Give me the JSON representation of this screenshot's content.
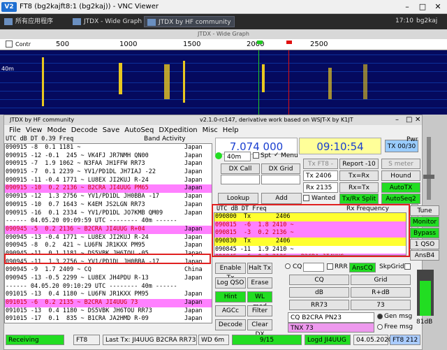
{
  "vnc": {
    "title": "FT8 (bg2kajft8:1 (bg2kaj)) - VNC Viewer",
    "time": "17:10",
    "user": "bg2kaj"
  },
  "taskbar": {
    "items": [
      "所有应用程序",
      "JTDX - Wide Graph",
      "JTDX by HF community"
    ]
  },
  "wide_graph": {
    "title": "JTDX - Wide Graph",
    "ticks": [
      "500",
      "1000",
      "1500",
      "2000",
      "2500"
    ],
    "label": "Contr",
    "band": "40m"
  },
  "jtdx": {
    "title": "JTDX by HF community",
    "version": "v2.1.0-rc147, derivative work based on WSJT-X by K1JT",
    "menu": [
      "File",
      "View",
      "Mode",
      "Decode",
      "Save",
      "AutoSeq",
      "DXpedition",
      "Misc",
      "Help"
    ],
    "header": "UTC  dB  DT 0.39  Freq",
    "band_activity": "Band Activity"
  },
  "band_activity": [
    {
      "t": "090915 -8  0.1 1181 ~ ",
      "c": "Japan",
      "cls": ""
    },
    {
      "t": "090915 -12 -0.1  245 ~ VK4FJ JR7NMH QN00",
      "c": "Japan",
      "cls": ""
    },
    {
      "t": "090915 -7  1.9 1062 ~ N3FAA JH1FFW RR73",
      "c": "Japan",
      "cls": ""
    },
    {
      "t": "090915 -7  0.1 2239 ~ YV1/PD1DL JH7IAJ -22",
      "c": "Japan",
      "cls": ""
    },
    {
      "t": "090915 -11 -0.4 1771 ~ LU8EX JI2KUJ R-24",
      "c": "Japan",
      "cls": ""
    },
    {
      "t": "090915 -10  0.2 2136 ~ B2CRA JI4UUG PM65",
      "c": "Japan",
      "cls": "pink red"
    },
    {
      "t": "090915 -12  1.3 2756 ~ YV1/PD1DL JH0BBA -17",
      "c": "Japan",
      "cls": ""
    },
    {
      "t": "090915 -10  0.7 1643 ~ K4EM JS2LGN RR73",
      "c": "Japan",
      "cls": ""
    },
    {
      "t": "090915 -16  0.1 2334 ~ YV1/PD1DL JO7KMB QM09",
      "c": "Japan",
      "cls": ""
    },
    {
      "t": "------ 04.05.20 09:09:59 UTC -------- 40m ------",
      "c": "",
      "cls": "ruler"
    },
    {
      "t": "090945 -5  0.2 2136 ~ B2CRA JI4UUG R+04",
      "c": "Japan",
      "cls": "pink red"
    },
    {
      "t": "090945 -13 -0.4 1771 ~ LU8EX JI2KUJ R-24",
      "c": "Japan",
      "cls": ""
    },
    {
      "t": "090945 -8  0.2  421 ~ LU6FN JR1KXX PM95",
      "c": "Japan",
      "cls": ""
    },
    {
      "t": "090945 -11  0.1 1181 ~ DS5VBK JH6TOU -05",
      "c": "Japan",
      "cls": ""
    },
    {
      "t": "090945 -11  1.3 2756 ~ YV1/PD1DL JH0BBA -17",
      "c": "Japan",
      "cls": ""
    },
    {
      "t": "090945 -9  1.7 2409 ~ CQ ",
      "c": "China",
      "cls": ""
    },
    {
      "t": "090945 -13 -0.5 2299 ~ LU8EX JH4PDU R-13",
      "c": "Japan",
      "cls": ""
    },
    {
      "t": "------ 04.05.20 09:10:29 UTC -------- 40m ------",
      "c": "",
      "cls": "ruler"
    },
    {
      "t": "091015 -13  0.4 1180 ~ LU6FN JR1KXX PM95",
      "c": "Japan",
      "cls": ""
    },
    {
      "t": "091015 -6  0.2 2135 ~ B2CRA JI4UUG 73",
      "c": "Japan",
      "cls": "pink red"
    },
    {
      "t": "091015 -13  0.4 1180 ~ DS5VBK JH6TOU RR73",
      "c": "Japan",
      "cls": ""
    },
    {
      "t": "091015 -17  0.1  835 ~ B1CRA JA2HMD R-09",
      "c": "Japan",
      "cls": ""
    },
    {
      "t": "091015 -8  0.1 2219 ~ YV1/PD1DL JH7IAJ -22",
      "c": "Japan",
      "cls": ""
    },
    {
      "t": "091015 -11  1.3 2756 ~ YV1/PD1DL JH0BBA -17",
      "c": "Japan",
      "cls": ""
    }
  ],
  "rx_header": "UTC  dB  DT Freq",
  "rx_frequency": "Rx Frequency",
  "rx_list": [
    {
      "t": "090800  Tx       2406",
      "cls": "yellow"
    },
    {
      "t": "090815  -6  1.8 2410 ~ ",
      "cls": "pink red"
    },
    {
      "t": "090815  -3  0.2 2136 ~ ",
      "cls": "pink red"
    },
    {
      "t": "090830  Tx       2406",
      "cls": "yellow"
    },
    {
      "t": "090845 -11  1.9 2410 ~ ",
      "cls": ""
    },
    {
      "t": "090845  -6  0.2 2136 ~  B2CRA JI4UUG",
      "cls": "pink red"
    }
  ],
  "controls": {
    "frequency": "7.074 000",
    "clock": "09:10:54",
    "tx_count": "TX 00/30",
    "band": "40m",
    "spt": "Spt",
    "menu": "Menu",
    "dx_call": "DX Call",
    "dx_grid": "DX Grid",
    "lookup": "Lookup",
    "add": "Add",
    "wanted": "Wanted",
    "tx_ft8": "Tx FT8 -",
    "report": "Report -10",
    "s_meter": "S meter",
    "tx_freq": "Tx 2406",
    "rx_freq": "Rx 2135",
    "tx_rx": "Tx=Rx",
    "rx_tx": "Rx=Tx",
    "hound": "Hound",
    "autotx": "AutoTX",
    "txrx_split": "Tx/Rx Split",
    "autoseq2": "AutoSeq2",
    "pwr": "Pwr",
    "tune": "Tune",
    "monitor": "Monitor",
    "bypass": "Bypass",
    "qso1": "1 QSO",
    "ansb4": "AnsB4"
  },
  "tx_panel": {
    "enable_tx": "Enable Tx",
    "halt_tx": "Halt Tx",
    "cq": "CQ",
    "rrr": "RRR",
    "anscq": "AnsCQ",
    "skpgrid": "SkpGrid",
    "log_qso": "Log QSO",
    "erase": "Erase",
    "hint": "Hint",
    "wl_mod": "WL mod",
    "agcc": "AGCc",
    "filter": "Filter",
    "decode": "Decode",
    "clear_dx": "Clear DX",
    "b_cq": "CQ",
    "b_grid": "Grid",
    "b_db": "dB",
    "b_rdb": "R+dB",
    "b_rr73": "RR73",
    "b_73": "73",
    "msg": "CQ B2CRA PN23",
    "tnx": "TNX 73",
    "gen_msg": "Gen msg",
    "free_msg": "Free msg",
    "level": "81dB"
  },
  "status": {
    "receiving": "Receiving",
    "mode": "FT8",
    "last_tx": "Last Tx: JI4UUG B2CRA RR73",
    "wd": "WD 6m",
    "count": "9/15",
    "logd": "Logd JI4UUG",
    "date": "04.05.2020",
    "ft8_num": "FT8  212"
  }
}
